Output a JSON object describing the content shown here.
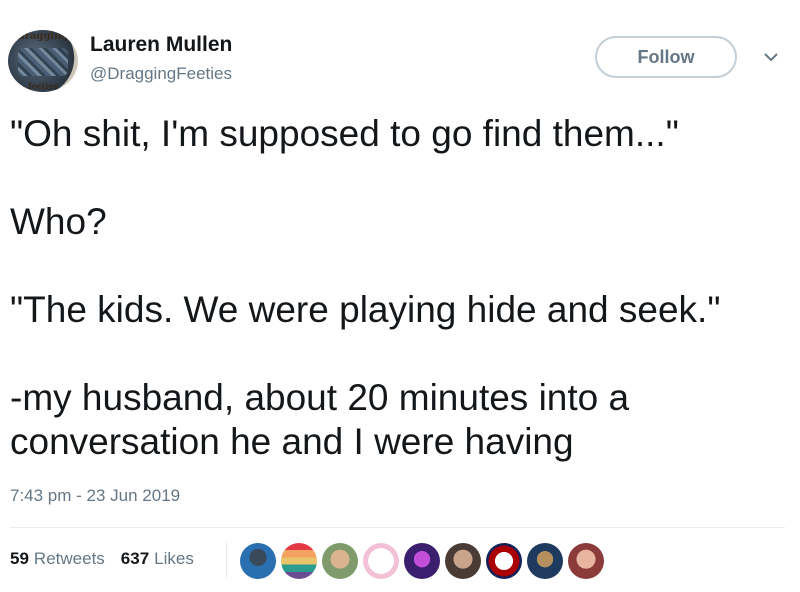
{
  "author": {
    "name": "Lauren Mullen",
    "handle": "@DraggingFeeties",
    "avatar_text_top": "dragging",
    "avatar_text_bottom": "feeties"
  },
  "follow_label": "Follow",
  "caret_icon": "chevron-down-icon",
  "tweet": {
    "line1": "\"Oh shit, I'm supposed to go find them...\"",
    "line2": "Who?",
    "line3": "\"The kids. We were playing hide and seek.\"",
    "line4": "-my husband, about 20 minutes into a",
    "line5": "conversation he and I were having"
  },
  "timestamp": "7:43 pm - 23 Jun 2019",
  "stats": {
    "retweets_count": "59",
    "retweets_label": "Retweets",
    "likes_count": "637",
    "likes_label": "Likes"
  },
  "colors": {
    "text": "#14171a",
    "secondary": "#657786",
    "border": "#c4ced6"
  }
}
